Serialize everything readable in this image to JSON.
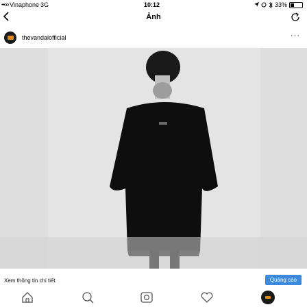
{
  "status_bar": {
    "signal": "•••oo",
    "carrier": "Vinaphone",
    "network": "3G",
    "time": "10:12",
    "battery_text": "33%",
    "battery_level": 0.33
  },
  "nav": {
    "back_icon": "chevron-left-icon",
    "title": "Ảnh",
    "refresh_icon": "refresh-icon"
  },
  "post": {
    "username": "thevandalofficial",
    "more_label": "···"
  },
  "cta": {
    "text": "Xem thông tin chi tiết",
    "ad_label": "Quảng cáo",
    "ad_color": "#3c8ade"
  },
  "actions": {
    "icons": [
      "home-icon",
      "search-icon",
      "camera-icon",
      "heart-icon",
      "profile-icon"
    ]
  }
}
